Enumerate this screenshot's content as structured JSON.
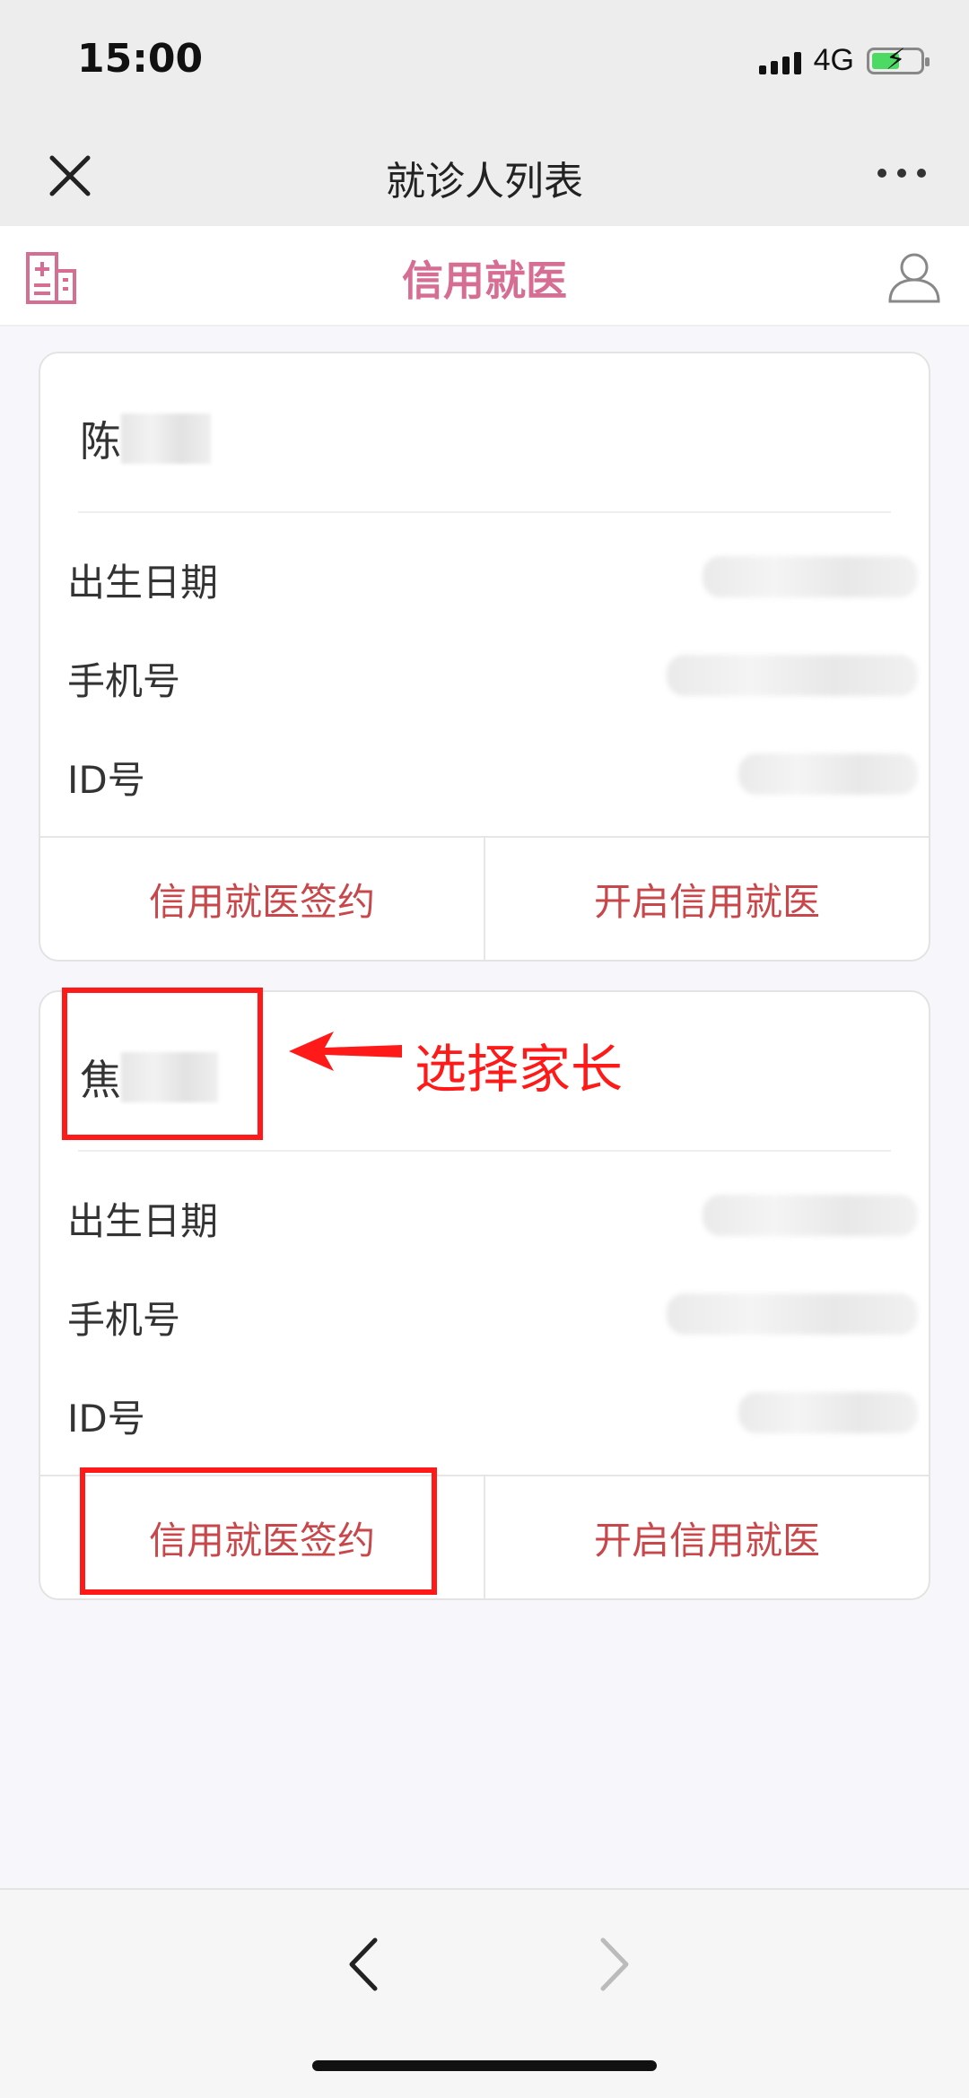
{
  "status": {
    "time": "15:00",
    "network": "4G"
  },
  "nav": {
    "title": "就诊人列表"
  },
  "header": {
    "title": "信用就医"
  },
  "rows_labels": {
    "birth": "出生日期",
    "phone": "手机号",
    "id": "ID号"
  },
  "patients": [
    {
      "surname": "陈",
      "sign_label": "信用就医签约",
      "open_label": "开启信用就医"
    },
    {
      "surname": "焦",
      "sign_label": "信用就医签约",
      "open_label": "开启信用就医"
    }
  ],
  "annotation": {
    "text": "选择家长",
    "color": "#ff1a1a"
  },
  "colors": {
    "brand": "#d66d93",
    "action": "#c8474a"
  },
  "icons": [
    "close-icon",
    "more-icon",
    "hospital-icon",
    "user-icon",
    "back-icon",
    "forward-icon"
  ]
}
